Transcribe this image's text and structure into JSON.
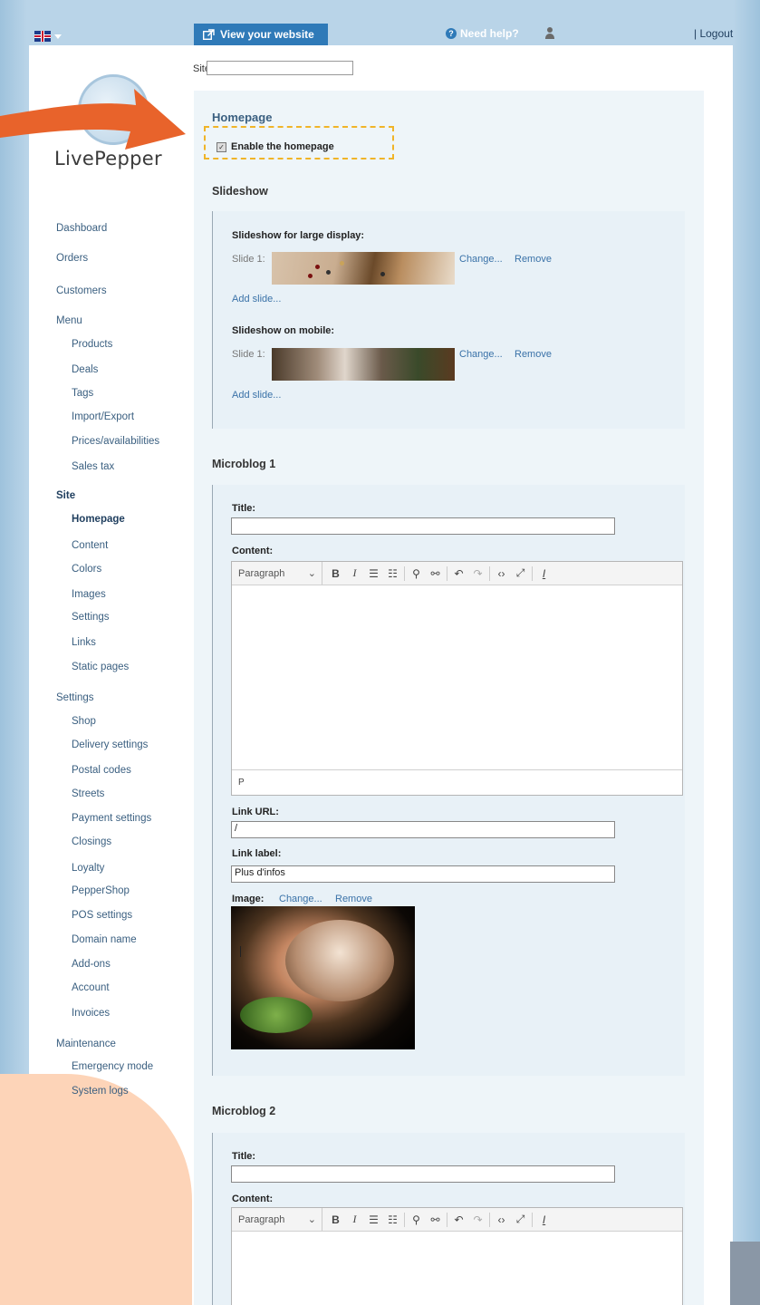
{
  "topbar": {
    "view_website": "View your website",
    "need_help": "Need help?",
    "logout": "| Logout"
  },
  "logo": {
    "text": "LivePepper"
  },
  "site_field": {
    "label": "Site:",
    "value": ""
  },
  "nav": {
    "items": [
      {
        "label": "Dashboard"
      },
      {
        "label": "Orders"
      },
      {
        "label": "Customers"
      },
      {
        "label": "Menu"
      },
      {
        "label": "Products"
      },
      {
        "label": "Deals"
      },
      {
        "label": "Tags"
      },
      {
        "label": "Import/Export"
      },
      {
        "label": "Prices/availabilities"
      },
      {
        "label": "Sales tax"
      },
      {
        "label": "Site"
      },
      {
        "label": "Homepage"
      },
      {
        "label": "Content"
      },
      {
        "label": "Colors"
      },
      {
        "label": "Images"
      },
      {
        "label": "Settings"
      },
      {
        "label": "Links"
      },
      {
        "label": "Static pages"
      },
      {
        "label": "Settings"
      },
      {
        "label": "Shop"
      },
      {
        "label": "Delivery settings"
      },
      {
        "label": "Postal codes"
      },
      {
        "label": "Streets"
      },
      {
        "label": "Payment settings"
      },
      {
        "label": "Closings"
      },
      {
        "label": "Loyalty"
      },
      {
        "label": "PepperShop"
      },
      {
        "label": "POS settings"
      },
      {
        "label": "Domain name"
      },
      {
        "label": "Add-ons"
      },
      {
        "label": "Account"
      },
      {
        "label": "Invoices"
      },
      {
        "label": "Maintenance"
      },
      {
        "label": "Emergency mode"
      },
      {
        "label": "System logs"
      }
    ]
  },
  "homepage": {
    "title": "Homepage",
    "enable_label": "Enable the homepage",
    "enable_checked": true
  },
  "slideshow": {
    "title": "Slideshow",
    "large_title": "Slideshow for large display:",
    "mobile_title": "Slideshow on mobile:",
    "slide_label": "Slide 1:",
    "change": "Change...",
    "remove": "Remove",
    "add_slide": "Add slide..."
  },
  "microblog1": {
    "title": "Microblog 1",
    "title_label": "Title:",
    "title_value": "",
    "content_label": "Content:",
    "status_path": "P",
    "link_url_label": "Link URL:",
    "link_url_value": "/",
    "link_label_label": "Link label:",
    "link_label_value": "Plus d'infos",
    "image_label": "Image:",
    "change": "Change...",
    "remove": "Remove"
  },
  "microblog2": {
    "title": "Microblog 2",
    "title_label": "Title:",
    "title_value": "",
    "content_label": "Content:"
  },
  "editor_toolbar": {
    "format": "Paragraph",
    "buttons": [
      "B",
      "I",
      "ordered-list",
      "bullet-list",
      "link",
      "unlink",
      "undo",
      "redo",
      "source-code",
      "fullscreen",
      "clear-format"
    ]
  },
  "colors": {
    "accent": "#2f7ab8",
    "highlight_dash": "#f0b428",
    "arrow": "#e8632b"
  }
}
